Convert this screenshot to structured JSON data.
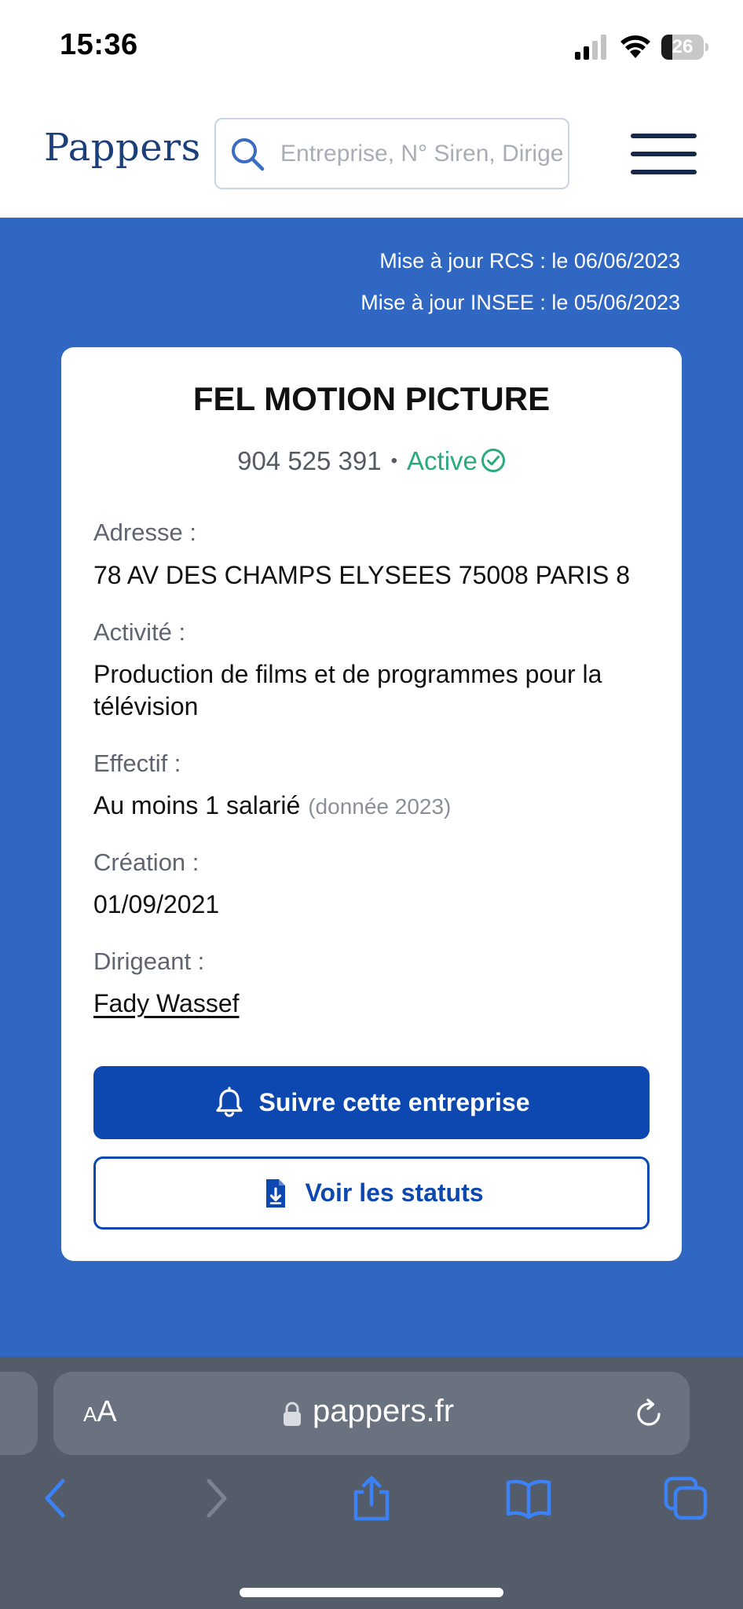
{
  "status_bar": {
    "time": "15:36",
    "battery": "26",
    "battery_level": 0.26
  },
  "header": {
    "logo": "Pappers",
    "search_placeholder": "Entreprise, N° Siren, Dirigeant"
  },
  "updates": {
    "rcs": "Mise à jour RCS : le 06/06/2023",
    "insee": "Mise à jour INSEE : le 05/06/2023"
  },
  "company": {
    "name": "FEL MOTION PICTURE",
    "siren": "904 525 391",
    "separator": "•",
    "status": "Active",
    "fields": {
      "address_label": "Adresse :",
      "address": "78 AV DES CHAMPS ELYSEES 75008 PARIS 8",
      "activity_label": "Activité :",
      "activity": "Production de films et de programmes pour la télévision",
      "staff_label": "Effectif :",
      "staff": "Au moins 1 salarié",
      "staff_note": "(donnée 2023)",
      "creation_label": "Création :",
      "creation": "01/09/2021",
      "director_label": "Dirigeant :",
      "director": "Fady Wassef"
    }
  },
  "actions": {
    "follow": "Suivre cette entreprise",
    "statuts": "Voir les statuts"
  },
  "browser": {
    "text_size": {
      "small": "A",
      "large": "A"
    },
    "url": "pappers.fr"
  },
  "colors": {
    "brand_blue": "#2f67c2",
    "button_blue": "#0d47b0",
    "active_green": "#2aaa81",
    "logo_navy": "#1b3f7a"
  }
}
